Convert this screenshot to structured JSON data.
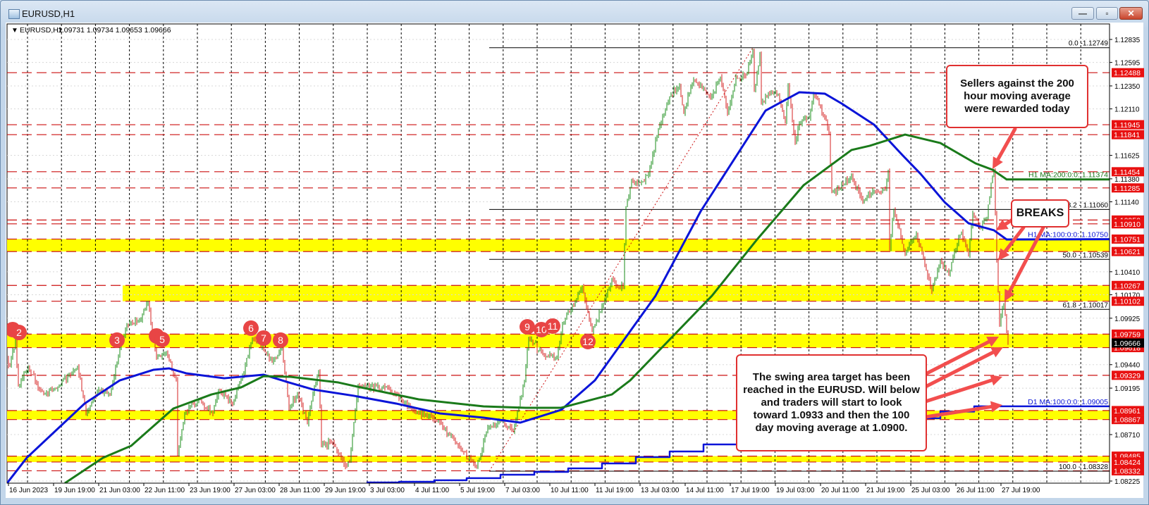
{
  "window": {
    "title": "EURUSD,H1",
    "buttons": {
      "minimize": "—",
      "restore": "▫",
      "close": "✕"
    }
  },
  "colors": {
    "bull": "#1a8c1a",
    "bear": "#d42020",
    "level": "#cc1010",
    "band": "#ffff00",
    "ma100": "#0a14d8",
    "ma200": "#1a7a1a",
    "d1ma": "#0a14d8",
    "arrow": "#f24e4e",
    "marker": "#e84545",
    "current": "#000000"
  },
  "chart_data": {
    "type": "bar",
    "style": "ohlc",
    "title": "EURUSD,H1",
    "header_values": "1.09731 1.09734 1.09653 1.09666",
    "x_unit": "H1 bar index",
    "ylim": [
      1.08225,
      1.12835
    ],
    "current_price": "1.09666",
    "y_ticks": [
      "1.12835",
      "1.12595",
      "1.12350",
      "1.12110",
      "1.11625",
      "1.11380",
      "1.11140",
      "1.10410",
      "1.10170",
      "1.09925",
      "1.09440",
      "1.09195",
      "1.08710",
      "1.08225"
    ],
    "x_ticks": [
      {
        "bar": 1,
        "label": "16 Jun 2023"
      },
      {
        "bar": 33,
        "label": "19 Jun 19:00"
      },
      {
        "bar": 65,
        "label": "21 Jun 03:00"
      },
      {
        "bar": 97,
        "label": "22 Jun 11:00"
      },
      {
        "bar": 129,
        "label": "23 Jun 19:00"
      },
      {
        "bar": 161,
        "label": "27 Jun 03:00"
      },
      {
        "bar": 193,
        "label": "28 Jun 11:00"
      },
      {
        "bar": 225,
        "label": "29 Jun 19:00"
      },
      {
        "bar": 257,
        "label": "3 Jul 03:00"
      },
      {
        "bar": 289,
        "label": "4 Jul 11:00"
      },
      {
        "bar": 321,
        "label": "5 Jul 19:00"
      },
      {
        "bar": 353,
        "label": "7 Jul 03:00"
      },
      {
        "bar": 385,
        "label": "10 Jul 11:00"
      },
      {
        "bar": 417,
        "label": "11 Jul 19:00"
      },
      {
        "bar": 449,
        "label": "13 Jul 03:00"
      },
      {
        "bar": 481,
        "label": "14 Jul 11:00"
      },
      {
        "bar": 513,
        "label": "17 Jul 19:00"
      },
      {
        "bar": 545,
        "label": "19 Jul 03:00"
      },
      {
        "bar": 577,
        "label": "20 Jul 11:00"
      },
      {
        "bar": 609,
        "label": "21 Jul 19:00"
      },
      {
        "bar": 641,
        "label": "25 Jul 03:00"
      },
      {
        "bar": 673,
        "label": "26 Jul 11:00"
      },
      {
        "bar": 705,
        "label": "27 Jul 19:00"
      }
    ],
    "price_path": [
      [
        0,
        1.095
      ],
      [
        2,
        1.0942
      ],
      [
        6,
        1.097
      ],
      [
        8,
        1.0922
      ],
      [
        15,
        1.094
      ],
      [
        26,
        1.0913
      ],
      [
        36,
        1.092
      ],
      [
        50,
        1.0942
      ],
      [
        56,
        1.0893
      ],
      [
        65,
        1.0918
      ],
      [
        73,
        1.0913
      ],
      [
        80,
        1.0962
      ],
      [
        85,
        1.0986
      ],
      [
        95,
        1.0991
      ],
      [
        100,
        1.101
      ],
      [
        103,
        1.0979
      ],
      [
        106,
        1.0952
      ],
      [
        113,
        1.0957
      ],
      [
        120,
        1.0928
      ],
      [
        121,
        1.0849
      ],
      [
        126,
        1.0893
      ],
      [
        136,
        1.0908
      ],
      [
        146,
        1.0893
      ],
      [
        150,
        1.0918
      ],
      [
        160,
        1.0903
      ],
      [
        168,
        1.0937
      ],
      [
        174,
        1.0972
      ],
      [
        181,
        1.0962
      ],
      [
        188,
        1.0947
      ],
      [
        195,
        1.0962
      ],
      [
        200,
        1.0898
      ],
      [
        206,
        1.0913
      ],
      [
        213,
        1.0883
      ],
      [
        218,
        1.0922
      ],
      [
        221,
        1.0937
      ],
      [
        223,
        1.0861
      ],
      [
        231,
        1.0863
      ],
      [
        240,
        1.0838
      ],
      [
        243,
        1.0842
      ],
      [
        249,
        1.0922
      ],
      [
        270,
        1.092
      ],
      [
        289,
        1.0896
      ],
      [
        307,
        1.0884
      ],
      [
        319,
        1.0862
      ],
      [
        333,
        1.0837
      ],
      [
        341,
        1.0878
      ],
      [
        350,
        1.0886
      ],
      [
        359,
        1.0874
      ],
      [
        367,
        1.0928
      ],
      [
        370,
        1.0972
      ],
      [
        382,
        1.0952
      ],
      [
        390,
        1.0952
      ],
      [
        394,
        1.0986
      ],
      [
        408,
        1.1025
      ],
      [
        415,
        1.0979
      ],
      [
        424,
        1.1011
      ],
      [
        429,
        1.1033
      ],
      [
        435,
        1.1023
      ],
      [
        437,
        1.1025
      ],
      [
        439,
        1.1109
      ],
      [
        443,
        1.1136
      ],
      [
        449,
        1.1134
      ],
      [
        455,
        1.1143
      ],
      [
        462,
        1.119
      ],
      [
        470,
        1.1224
      ],
      [
        477,
        1.1236
      ],
      [
        480,
        1.1207
      ],
      [
        487,
        1.1242
      ],
      [
        499,
        1.1222
      ],
      [
        506,
        1.1244
      ],
      [
        511,
        1.1205
      ],
      [
        517,
        1.1244
      ],
      [
        524,
        1.1246
      ],
      [
        529,
        1.1273
      ],
      [
        530,
        1.1229
      ],
      [
        534,
        1.1268
      ],
      [
        535,
        1.1217
      ],
      [
        542,
        1.1229
      ],
      [
        547,
        1.1227
      ],
      [
        552,
        1.1198
      ],
      [
        554,
        1.1236
      ],
      [
        559,
        1.1175
      ],
      [
        562,
        1.1195
      ],
      [
        569,
        1.1202
      ],
      [
        572,
        1.1227
      ],
      [
        580,
        1.1202
      ],
      [
        583,
        1.1185
      ],
      [
        585,
        1.1124
      ],
      [
        590,
        1.1128
      ],
      [
        599,
        1.1141
      ],
      [
        607,
        1.1114
      ],
      [
        615,
        1.1126
      ],
      [
        623,
        1.1126
      ],
      [
        625,
        1.1146
      ],
      [
        626,
        1.1065
      ],
      [
        629,
        1.1106
      ],
      [
        637,
        1.106
      ],
      [
        645,
        1.108
      ],
      [
        652,
        1.1043
      ],
      [
        656,
        1.1021
      ],
      [
        662,
        1.1053
      ],
      [
        668,
        1.1038
      ],
      [
        672,
        1.1062
      ],
      [
        677,
        1.1082
      ],
      [
        682,
        1.1058
      ],
      [
        685,
        1.1102
      ],
      [
        690,
        1.1087
      ],
      [
        695,
        1.1096
      ],
      [
        698,
        1.1134
      ],
      [
        700,
        1.1146
      ],
      [
        702,
        1.1053
      ],
      [
        704,
        1.0987
      ],
      [
        707,
        1.1008
      ],
      [
        709,
        1.0979
      ],
      [
        710,
        1.09666
      ]
    ],
    "ma_series": [
      {
        "name": "H1 MA:100:0:0: 1.10750",
        "label": "H1 MA:100:0:0: 1.10750",
        "color_key": "ma100",
        "value": 1.1075,
        "points": [
          [
            0,
            1.08203
          ],
          [
            14,
            1.08468
          ],
          [
            55,
            1.09034
          ],
          [
            80,
            1.09276
          ],
          [
            104,
            1.09387
          ],
          [
            115,
            1.09401
          ],
          [
            127,
            1.0935
          ],
          [
            154,
            1.09298
          ],
          [
            182,
            1.09335
          ],
          [
            200,
            1.09254
          ],
          [
            217,
            1.09181
          ],
          [
            246,
            1.09115
          ],
          [
            276,
            1.09034
          ],
          [
            307,
            1.08931
          ],
          [
            338,
            1.08887
          ],
          [
            364,
            1.08835
          ],
          [
            393,
            1.08968
          ],
          [
            417,
            1.09276
          ],
          [
            460,
            1.10159
          ],
          [
            492,
            1.11041
          ],
          [
            538,
            1.12092
          ],
          [
            562,
            1.12284
          ],
          [
            580,
            1.12269
          ],
          [
            592,
            1.12166
          ],
          [
            615,
            1.11945
          ],
          [
            635,
            1.11629
          ],
          [
            648,
            1.11431
          ],
          [
            665,
            1.11137
          ],
          [
            682,
            1.10916
          ],
          [
            700,
            1.10843
          ],
          [
            709,
            1.10747
          ],
          [
            790,
            1.1075
          ]
        ]
      },
      {
        "name": "H1 MA:200:0:0: 1.11374",
        "label": "H1 MA:200:0:0: 1.11374",
        "color_key": "ma200",
        "value": 1.11374,
        "points": [
          [
            41,
            1.08203
          ],
          [
            68,
            1.08468
          ],
          [
            88,
            1.08593
          ],
          [
            118,
            1.08982
          ],
          [
            145,
            1.09129
          ],
          [
            166,
            1.09203
          ],
          [
            182,
            1.0932
          ],
          [
            201,
            1.09313
          ],
          [
            235,
            1.09254
          ],
          [
            246,
            1.09218
          ],
          [
            292,
            1.09078
          ],
          [
            338,
            1.09004
          ],
          [
            368,
            1.0899
          ],
          [
            393,
            1.0899
          ],
          [
            429,
            1.09129
          ],
          [
            442,
            1.09276
          ],
          [
            500,
            1.10159
          ],
          [
            532,
            1.10747
          ],
          [
            565,
            1.11313
          ],
          [
            599,
            1.11681
          ],
          [
            612,
            1.11725
          ],
          [
            637,
            1.11842
          ],
          [
            662,
            1.11754
          ],
          [
            687,
            1.11541
          ],
          [
            699,
            1.11475
          ],
          [
            709,
            1.11374
          ],
          [
            790,
            1.11374
          ]
        ]
      },
      {
        "name": "D1 MA:100:0:0: 1.09005",
        "label": "D1 MA:100:0:0: 1.09005",
        "color_key": "d1ma",
        "value": 1.09005,
        "step": true,
        "points": [
          [
            255,
            1.0821
          ],
          [
            278,
            1.08218
          ],
          [
            303,
            1.08233
          ],
          [
            326,
            1.08255
          ],
          [
            350,
            1.08291
          ],
          [
            374,
            1.08321
          ],
          [
            398,
            1.08357
          ],
          [
            422,
            1.08409
          ],
          [
            446,
            1.08475
          ],
          [
            470,
            1.08534
          ],
          [
            494,
            1.08607
          ],
          [
            518,
            1.0866
          ],
          [
            542,
            1.0871
          ],
          [
            566,
            1.0876
          ],
          [
            590,
            1.088
          ],
          [
            614,
            1.0884
          ],
          [
            638,
            1.0888
          ],
          [
            662,
            1.0895
          ],
          [
            686,
            1.09005
          ],
          [
            790,
            1.09005
          ]
        ]
      }
    ],
    "levels": [
      "1.12488",
      "1.11945",
      "1.11841",
      "1.11454",
      "1.11285",
      "1.10950",
      "1.10910",
      "1.10751",
      "1.10621",
      "1.10267",
      "1.10102",
      "1.09759",
      "1.09618",
      "1.09329",
      "1.08961",
      "1.08867",
      "1.08485",
      "1.08424",
      "1.08332"
    ],
    "bands": [
      {
        "high": 1.10751,
        "low": 1.10621,
        "from_bar": 0
      },
      {
        "high": 1.10267,
        "low": 1.10102,
        "from_bar": 82
      },
      {
        "high": 1.09759,
        "low": 1.09618,
        "from_bar": 0
      },
      {
        "high": 1.08961,
        "low": 1.08867,
        "from_bar": 0
      },
      {
        "high": 1.08485,
        "low": 1.08424,
        "from_bar": 0
      }
    ],
    "fibonacci": {
      "from_bar": 342,
      "low": 1.08328,
      "high": 1.12749,
      "high_bar": 529,
      "levels": [
        {
          "price": 1.12749,
          "label": "0.0 -1.12749"
        },
        {
          "price": 1.1106,
          "label": "38.2 - 1.11060"
        },
        {
          "price": 1.10539,
          "label": "50.0 - 1.10539"
        },
        {
          "price": 1.10017,
          "label": "61.8 - 1.10017"
        },
        {
          "price": 1.08328,
          "label": "100.0 - 1.08328"
        }
      ]
    },
    "markers": [
      {
        "label": "",
        "bar": 4,
        "price": 1.09806
      },
      {
        "label": "2",
        "bar": 8.5,
        "price": 1.09776
      },
      {
        "label": "3",
        "bar": 78,
        "price": 1.09696
      },
      {
        "label": "",
        "bar": 106,
        "price": 1.0974
      },
      {
        "label": "5",
        "bar": 110,
        "price": 1.09703
      },
      {
        "label": "6",
        "bar": 173,
        "price": 1.09821
      },
      {
        "label": "7",
        "bar": 182,
        "price": 1.09718
      },
      {
        "label": "8",
        "bar": 194,
        "price": 1.09696
      },
      {
        "label": "9",
        "bar": 369,
        "price": 1.09835
      },
      {
        "label": "10",
        "bar": 379,
        "price": 1.09806
      },
      {
        "label": "11",
        "bar": 387,
        "price": 1.09843
      },
      {
        "label": "12",
        "bar": 412,
        "price": 1.09681
      }
    ]
  },
  "annotations": {
    "sellers": [
      "Sellers against the 200",
      "hour moving average",
      "were rewarded today"
    ],
    "breaks": "BREAKS",
    "swing": [
      "The swing area target has been",
      "reached in the EURUSD.  Will below",
      "and traders will start to look",
      "toward 1.0933 and then the 100",
      "day moving average at 1.0900."
    ]
  }
}
